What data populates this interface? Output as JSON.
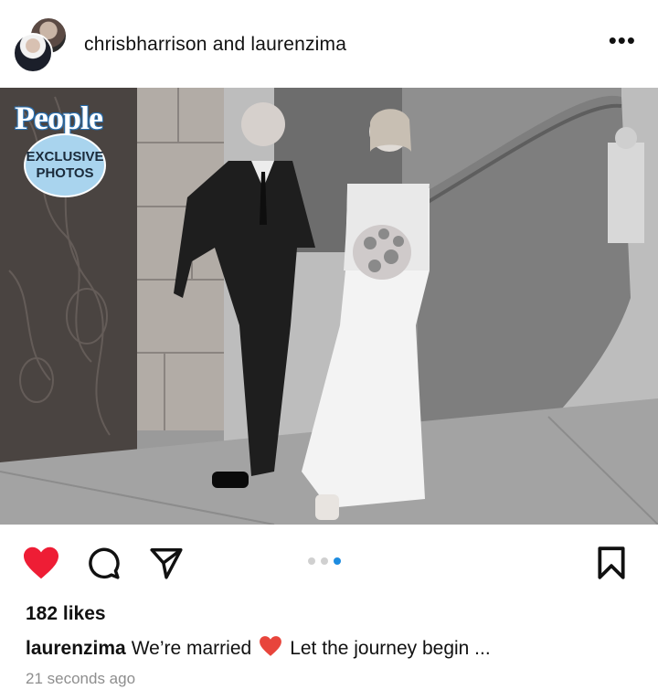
{
  "post": {
    "header": {
      "usernames": "chrisbharrison and laurenzima",
      "more_icon": "more-horizontal-icon"
    },
    "badge": {
      "brand": "People",
      "line1": "EXCLUSIVE",
      "line2": "PHOTOS",
      "color": "#a9d4ee"
    },
    "actions": {
      "like_icon": "heart-filled-icon",
      "comment_icon": "comment-icon",
      "share_icon": "send-icon",
      "save_icon": "bookmark-icon",
      "like_color": "#ee1d35"
    },
    "carousel": {
      "count": 3,
      "active_index": 2,
      "active_color": "#1d8ce0"
    },
    "likes": "182 likes",
    "caption": {
      "user": "laurenzima",
      "text_before": "We’re married",
      "emoji": "red-heart-emoji",
      "text_after": "Let the journey begin ..."
    },
    "timestamp": "21 seconds ago"
  }
}
